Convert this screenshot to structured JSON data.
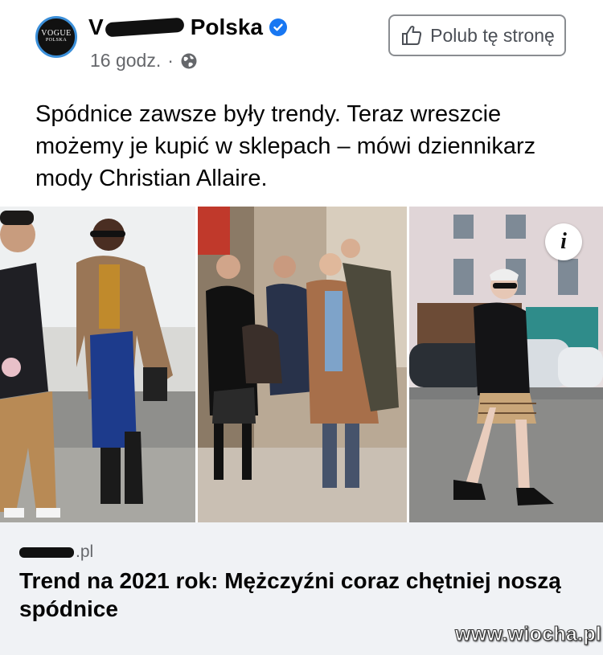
{
  "post": {
    "page_name_suffix": "Polska",
    "page_name_prefix": "V",
    "avatar_text_line1": "VOGUE",
    "avatar_text_line2": "POLSKA",
    "time": "16 godz.",
    "separator": "·",
    "like_button_label": "Polub tę stronę",
    "text": "Spódnice zawsze były trendy. Teraz wreszcie możemy je kupić w sklepach – mówi dziennikarz mody Christian Allaire."
  },
  "link": {
    "domain_suffix": ".pl",
    "title": "Trend na 2021 rok: Mężczyźni coraz chętniej noszą spódnice"
  },
  "watermark": "www.wiocha.pl",
  "icons": {
    "verified": "verified-badge-icon",
    "globe": "globe-icon",
    "like": "thumbs-up-icon",
    "info": "info-icon"
  },
  "colors": {
    "verified_blue": "#1877f2",
    "meta_gray": "#65676b",
    "link_bg": "#f0f2f5"
  }
}
